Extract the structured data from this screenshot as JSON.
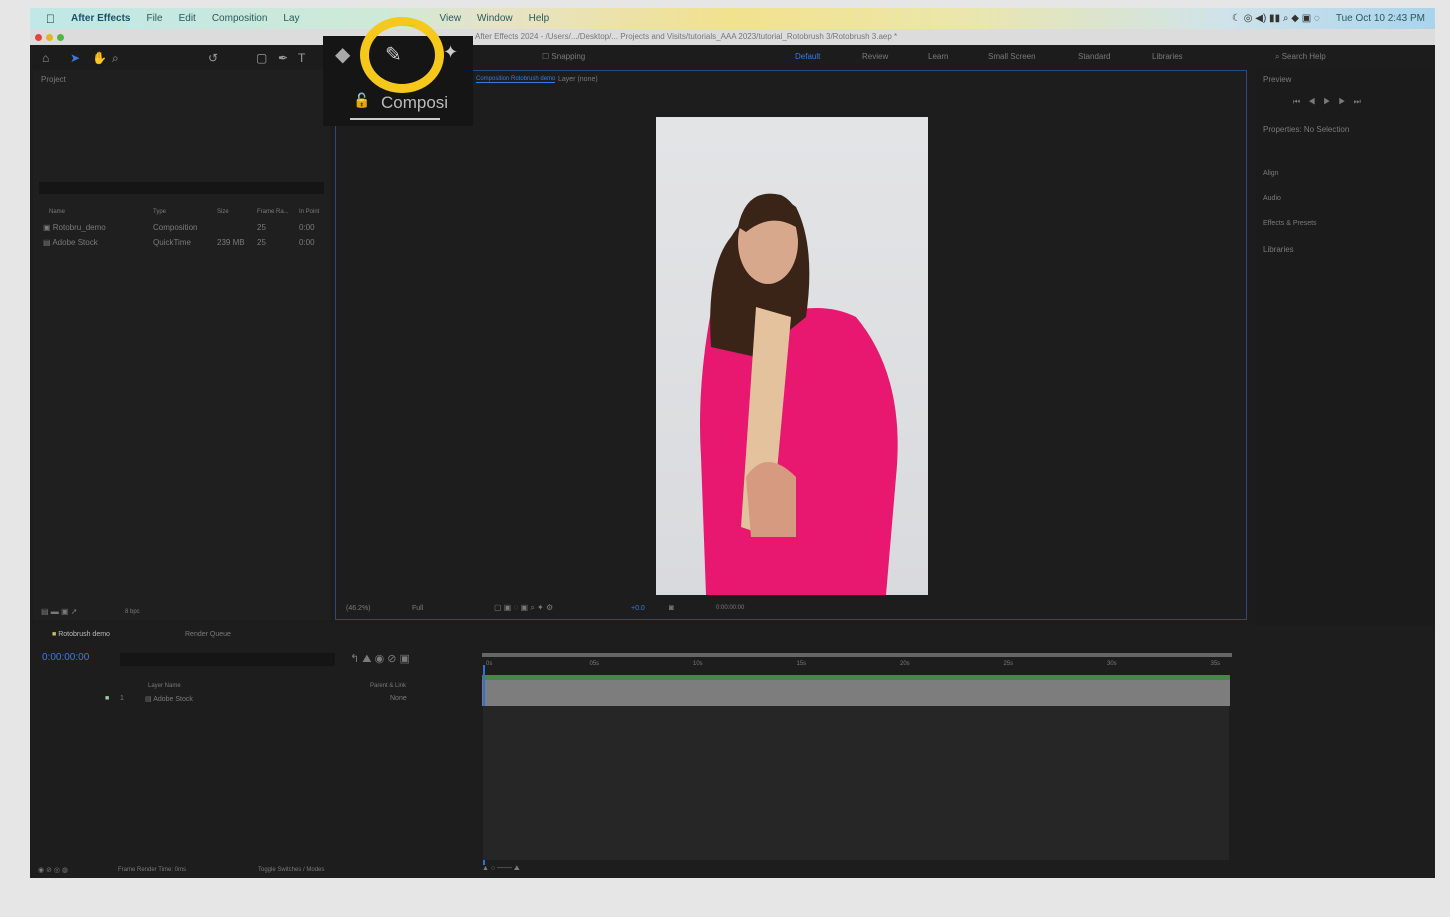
{
  "menubar": {
    "app": "After Effects",
    "items": [
      "File",
      "Edit",
      "Composition",
      "Lay",
      "View",
      "Window",
      "Help"
    ],
    "clock": "Tue Oct 10  2:43 PM"
  },
  "titlebar": {
    "title": "After Effects 2024 - /Users/.../Desktop/... Projects and Visits/tutorials_AAA 2023/tutorial_Rotobrush 3/Rotobrush 3.aep *"
  },
  "toolbar": {
    "snapping": "Snapping",
    "workspaces": [
      "Default",
      "Review",
      "Learn",
      "Small Screen",
      "Standard",
      "Libraries"
    ],
    "search_placeholder": "Search Help",
    "highlighted_tool": "roto-brush-tool"
  },
  "popup": {
    "tab": "Composi"
  },
  "project": {
    "title": "Project",
    "columns": [
      "Name",
      "Type",
      "Size",
      "Frame Ra...",
      "In Point"
    ],
    "rows": [
      {
        "name": "Rotobru_demo",
        "type": "Composition",
        "size": "",
        "fps": "25",
        "in": "0:00"
      },
      {
        "name": "Adobe Stock",
        "type": "QuickTime",
        "size": "239 MB",
        "fps": "25",
        "in": "0:00"
      }
    ],
    "bpc": "8 bpc"
  },
  "viewer": {
    "tabs": [
      "Composition Rotobrush demo",
      "Layer (none)"
    ],
    "zoom": "(46.2%)",
    "resolution": "Full",
    "exposure": "+0.0",
    "timecode": "0:00:00:00"
  },
  "right": {
    "preview": "Preview",
    "properties": "Properties: No Selection",
    "sections": [
      "Align",
      "Audio",
      "Effects & Presets",
      "Libraries"
    ]
  },
  "timeline": {
    "tabs": [
      "Rotobrush demo",
      "Render Queue"
    ],
    "timecode": "0:00:00:00",
    "layer_header": "Layer Name",
    "parent_header": "Parent & Link",
    "layer": {
      "index": "1",
      "name": "Adobe Stock",
      "parent": "None"
    },
    "ruler": [
      "0s",
      "05s",
      "10s",
      "15s",
      "20s",
      "25s",
      "30s",
      "35s"
    ],
    "status": "Frame Render Time: 0ms",
    "toggle": "Toggle Switches / Modes"
  },
  "colors": {
    "highlight": "#f6c81c",
    "accent": "#2f6fd6",
    "track_green": "#3f8a4a"
  }
}
